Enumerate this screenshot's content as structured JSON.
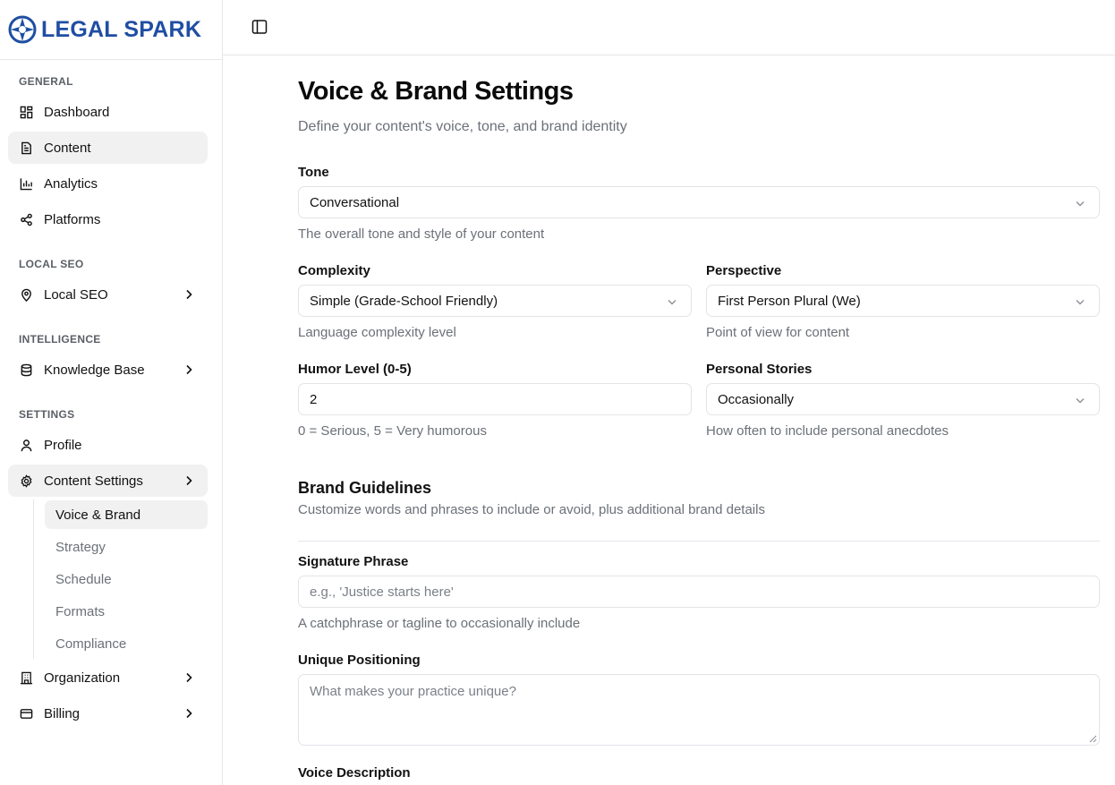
{
  "brand": {
    "name": "LEGAL SPARK",
    "color": "#1f4ea3"
  },
  "sidebar": {
    "groups": [
      {
        "label": "GENERAL"
      },
      {
        "label": "LOCAL SEO"
      },
      {
        "label": "INTELLIGENCE"
      },
      {
        "label": "SETTINGS"
      }
    ],
    "items": [
      {
        "label": "Dashboard",
        "icon": "dashboard-icon"
      },
      {
        "label": "Content",
        "icon": "document-icon",
        "active": true
      },
      {
        "label": "Analytics",
        "icon": "bar-chart-icon"
      },
      {
        "label": "Platforms",
        "icon": "share-icon"
      },
      {
        "label": "Local SEO",
        "icon": "map-pin-icon",
        "expandable": true
      },
      {
        "label": "Knowledge Base",
        "icon": "database-icon",
        "expandable": true
      },
      {
        "label": "Profile",
        "icon": "user-icon"
      },
      {
        "label": "Content Settings",
        "icon": "gear-icon",
        "expandable": true,
        "expanded": true
      },
      {
        "label": "Organization",
        "icon": "building-icon",
        "expandable": true
      },
      {
        "label": "Billing",
        "icon": "credit-card-icon",
        "expandable": true
      }
    ],
    "sub_items": [
      {
        "label": "Voice & Brand",
        "active": true
      },
      {
        "label": "Strategy"
      },
      {
        "label": "Schedule"
      },
      {
        "label": "Formats"
      },
      {
        "label": "Compliance"
      }
    ]
  },
  "page": {
    "title": "Voice & Brand Settings",
    "subtitle": "Define your content's voice, tone, and brand identity"
  },
  "form": {
    "tone": {
      "label": "Tone",
      "value": "Conversational",
      "help": "The overall tone and style of your content"
    },
    "complexity": {
      "label": "Complexity",
      "value": "Simple (Grade-School Friendly)",
      "help": "Language complexity level"
    },
    "perspective": {
      "label": "Perspective",
      "value": "First Person Plural (We)",
      "help": "Point of view for content"
    },
    "humor": {
      "label": "Humor Level (0-5)",
      "value": "2",
      "help": "0 = Serious, 5 = Very humorous"
    },
    "personal_stories": {
      "label": "Personal Stories",
      "value": "Occasionally",
      "help": "How often to include personal anecdotes"
    }
  },
  "brand_guidelines": {
    "title": "Brand Guidelines",
    "subtitle": "Customize words and phrases to include or avoid, plus additional brand details",
    "signature_phrase": {
      "label": "Signature Phrase",
      "placeholder": "e.g., 'Justice starts here'",
      "help": "A catchphrase or tagline to occasionally include"
    },
    "unique_positioning": {
      "label": "Unique Positioning",
      "placeholder": "What makes your practice unique?"
    },
    "voice_description": {
      "label": "Voice Description"
    }
  }
}
